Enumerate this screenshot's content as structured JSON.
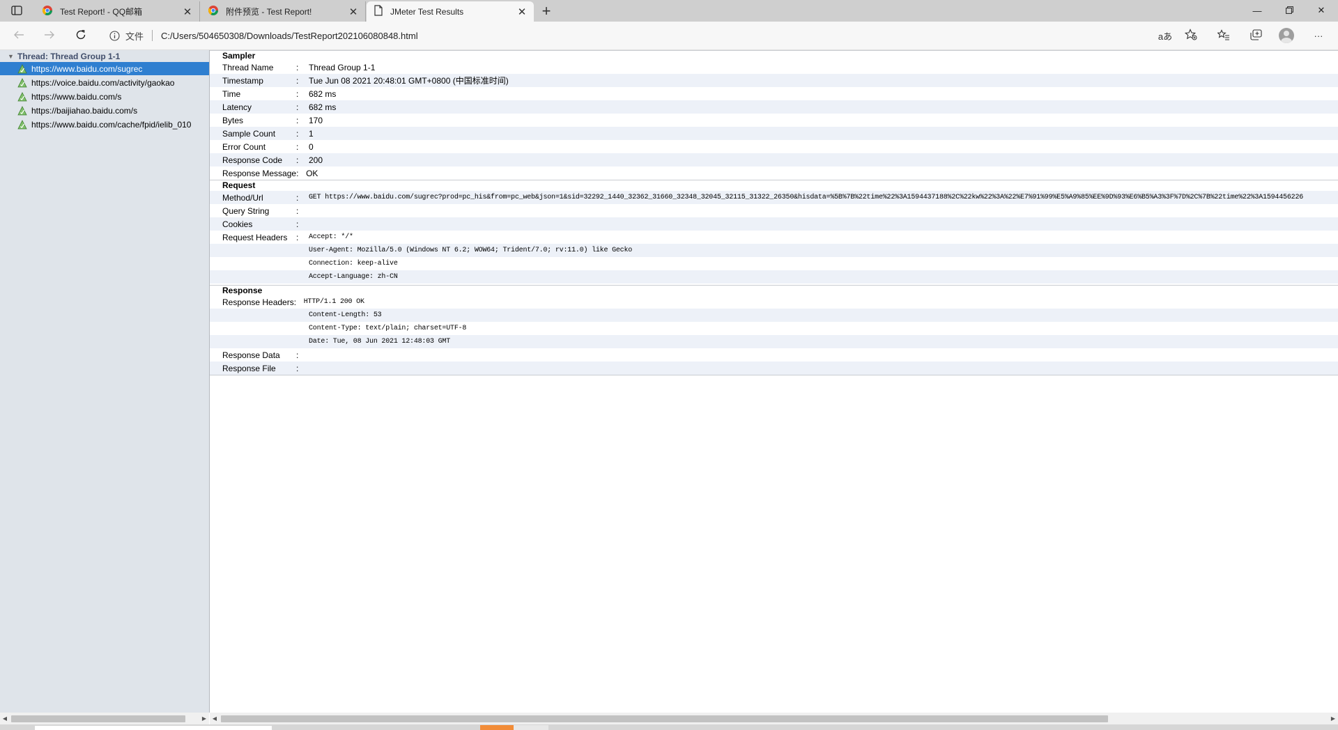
{
  "browser": {
    "tabs": [
      {
        "title": "Test Report! - QQ邮箱",
        "icon": "chrome-icon"
      },
      {
        "title": "附件预览 - Test Report!",
        "icon": "chrome-icon"
      },
      {
        "title": "JMeter Test Results",
        "icon": "document-icon",
        "active": true
      }
    ],
    "new_tab_label": "+",
    "address": {
      "scheme_label": "文件",
      "url": "C:/Users/504650308/Downloads/TestReport202106080848.html"
    },
    "read_aloud_label": "aあ",
    "accent_color": "#2f7fd0"
  },
  "tree": {
    "root_label": "Thread: Thread Group 1-1",
    "items": [
      {
        "label": "https://www.baidu.com/sugrec",
        "selected": true
      },
      {
        "label": "https://voice.baidu.com/activity/gaokao"
      },
      {
        "label": "https://www.baidu.com/s"
      },
      {
        "label": "https://baijiahao.baidu.com/s"
      },
      {
        "label": "https://www.baidu.com/cache/fpid/ielib_010"
      }
    ]
  },
  "sampler": {
    "heading": "Sampler",
    "rows": [
      {
        "key": "Thread Name",
        "value": "Thread Group 1-1"
      },
      {
        "key": "Timestamp",
        "value": "Tue Jun 08 2021 20:48:01 GMT+0800 (中国标准时间)"
      },
      {
        "key": "Time",
        "value": "682 ms"
      },
      {
        "key": "Latency",
        "value": "682 ms"
      },
      {
        "key": "Bytes",
        "value": "170"
      },
      {
        "key": "Sample Count",
        "value": "1"
      },
      {
        "key": "Error Count",
        "value": "0"
      },
      {
        "key": "Response Code",
        "value": "200"
      },
      {
        "key": "Response Message",
        "value": "OK"
      }
    ]
  },
  "request": {
    "heading": "Request",
    "method_url_key": "Method/Url",
    "method_url": "GET https://www.baidu.com/sugrec?prod=pc_his&from=pc_web&json=1&sid=32292_1440_32362_31660_32348_32045_32115_31322_26350&hisdata=%5B%7B%22time%22%3A1594437188%2C%22kw%22%3A%22%E7%91%99%E5%A9%85%EE%9D%93%E6%B5%A3%3F%7D%2C%7B%22time%22%3A1594456226",
    "query_string_key": "Query String",
    "cookies_key": "Cookies",
    "headers_key": "Request Headers",
    "headers": [
      "Accept: */*",
      "User-Agent: Mozilla/5.0 (Windows NT 6.2; WOW64; Trident/7.0; rv:11.0) like Gecko",
      "Connection: keep-alive",
      "Accept-Language: zh-CN"
    ]
  },
  "response": {
    "heading": "Response",
    "headers_key": "Response Headers",
    "headers": [
      "HTTP/1.1 200 OK",
      "Content-Length: 53",
      "Content-Type: text/plain; charset=UTF-8",
      "Date: Tue, 08 Jun 2021 12:48:03 GMT"
    ],
    "data_key": "Response Data",
    "file_key": "Response File"
  },
  "labels": {
    "colon": ":",
    "response_message_colon": ":"
  }
}
